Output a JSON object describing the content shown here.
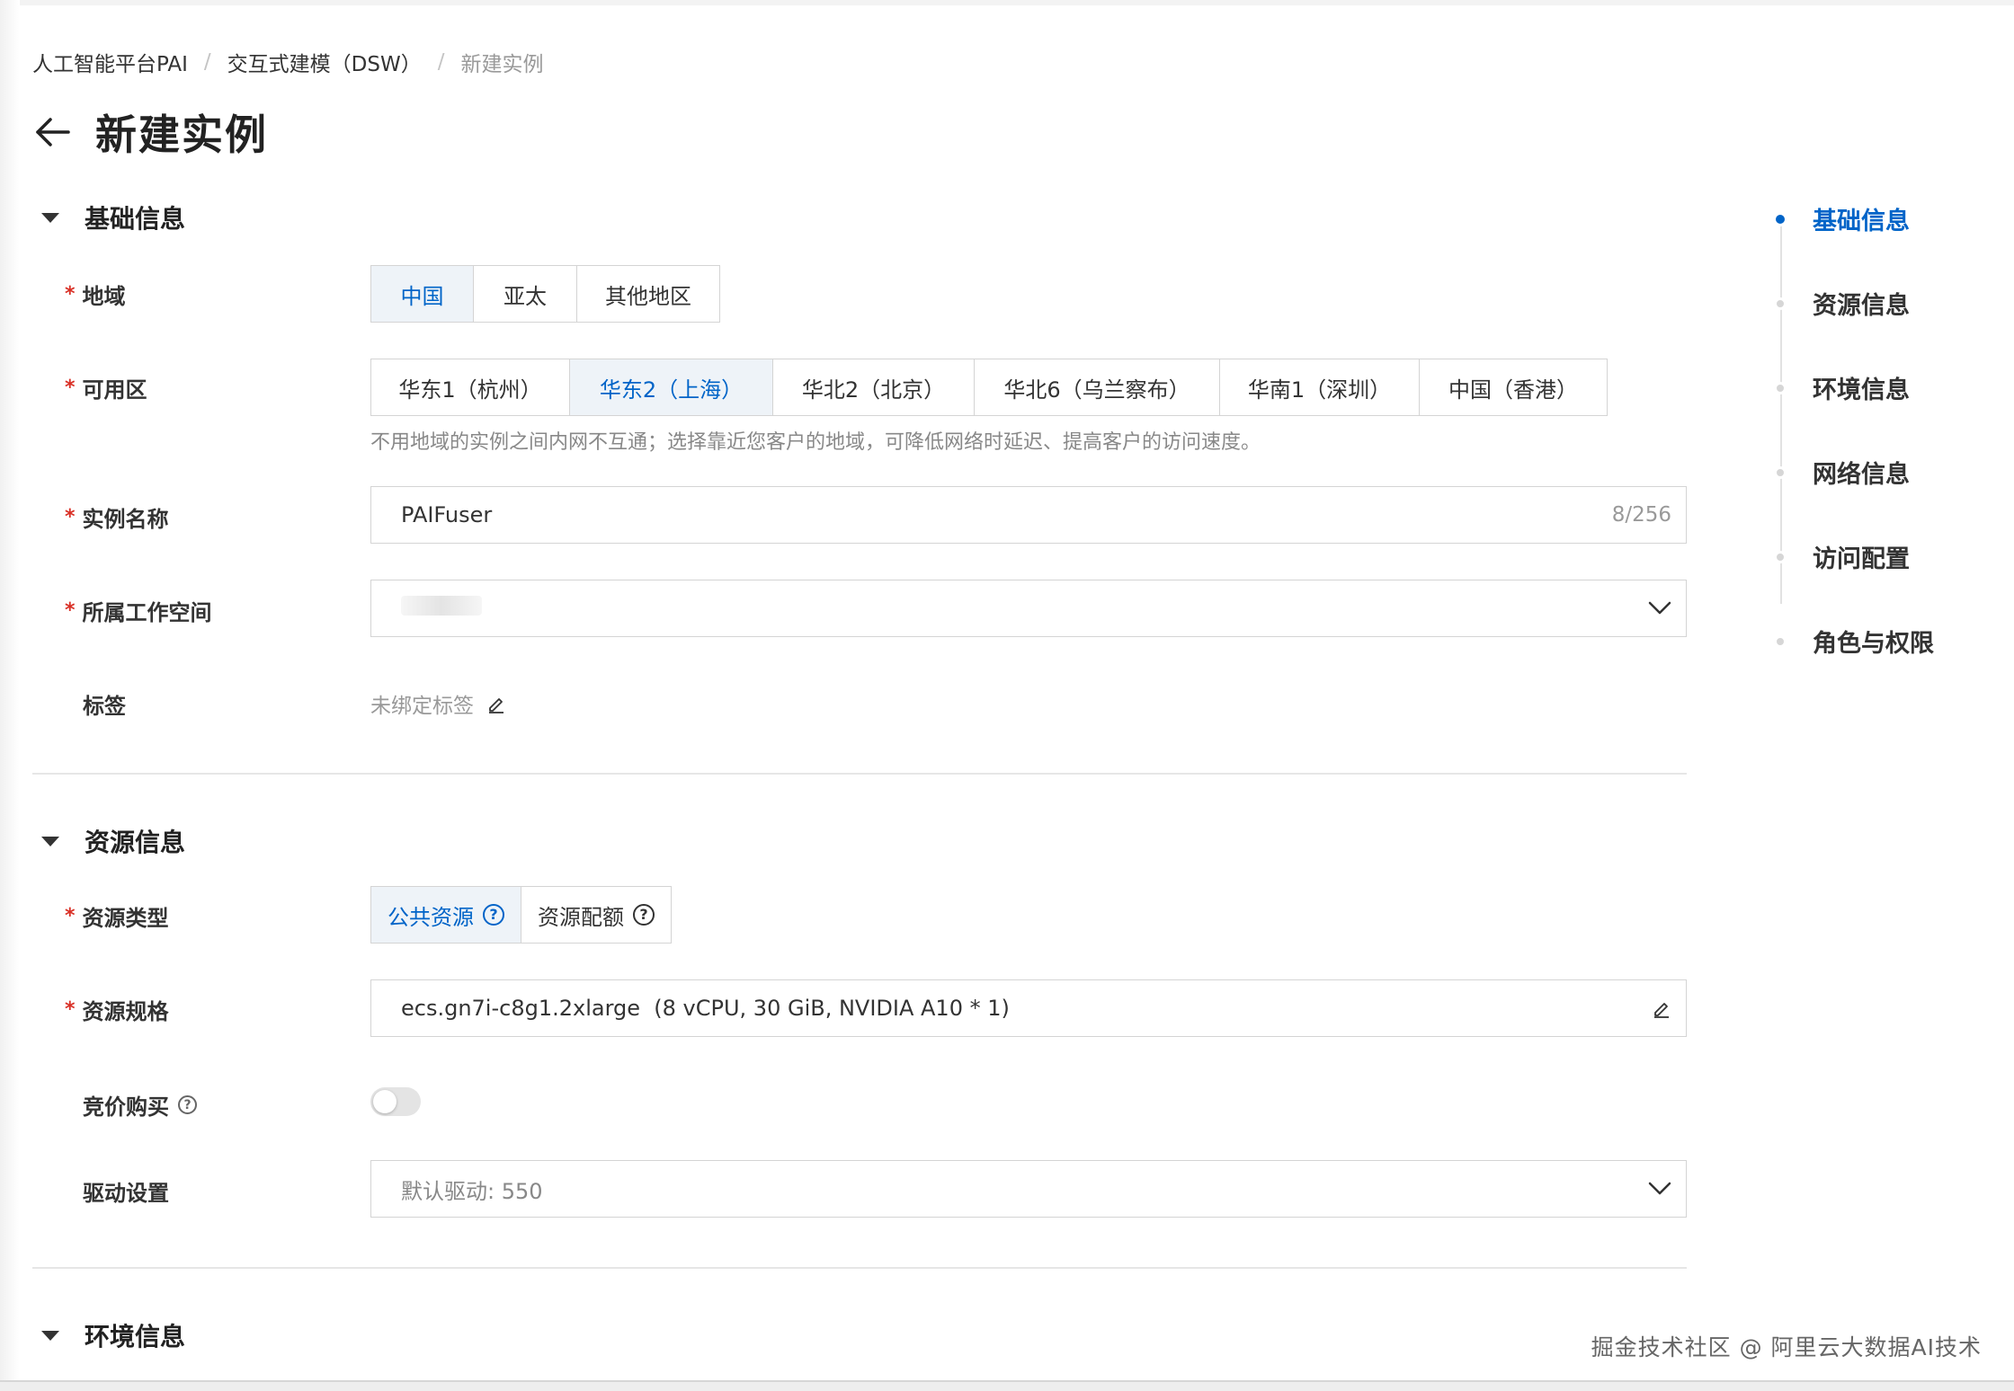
{
  "breadcrumb": {
    "items": [
      "人工智能平台PAI",
      "交互式建模（DSW）"
    ],
    "separator": "/",
    "current": "新建实例"
  },
  "page": {
    "title": "新建实例",
    "back_icon": "arrow-left-icon"
  },
  "sections": {
    "basic": {
      "title": "基础信息",
      "region": {
        "label": "地域",
        "options": [
          "中国",
          "亚太",
          "其他地区"
        ],
        "selected": "中国"
      },
      "zone": {
        "label": "可用区",
        "options": [
          "华东1（杭州）",
          "华东2（上海）",
          "华北2（北京）",
          "华北6（乌兰察布）",
          "华南1（深圳）",
          "中国（香港）"
        ],
        "selected": "华东2（上海）",
        "hint": "不用地域的实例之间内网不互通；选择靠近您客户的地域，可降低网络时延迟、提高客户的访问速度。"
      },
      "instance_name": {
        "label": "实例名称",
        "value": "PAIFuser",
        "count": "8/256"
      },
      "workspace": {
        "label": "所属工作空间"
      },
      "tags": {
        "label": "标签",
        "value": "未绑定标签"
      }
    },
    "resource": {
      "title": "资源信息",
      "resource_type": {
        "label": "资源类型",
        "options": [
          "公共资源",
          "资源配额"
        ],
        "selected": "公共资源"
      },
      "spec": {
        "label": "资源规格",
        "value": "ecs.gn7i-c8g1.2xlarge  (8 vCPU, 30 GiB, NVIDIA A10 * 1)"
      },
      "bidding": {
        "label": "竞价购买",
        "enabled": false
      },
      "driver": {
        "label": "驱动设置",
        "value": "默认驱动: 550"
      }
    },
    "env": {
      "title": "环境信息"
    }
  },
  "anchor_nav": {
    "items": [
      "基础信息",
      "资源信息",
      "环境信息",
      "网络信息",
      "访问配置",
      "角色与权限"
    ],
    "active": "基础信息"
  },
  "watermark": "掘金技术社区 @ 阿里云大数据AI技术",
  "colors": {
    "accent": "#0064c8",
    "required": "#d93026",
    "active_bg": "#eef3f8",
    "border": "#d4d4d4"
  }
}
